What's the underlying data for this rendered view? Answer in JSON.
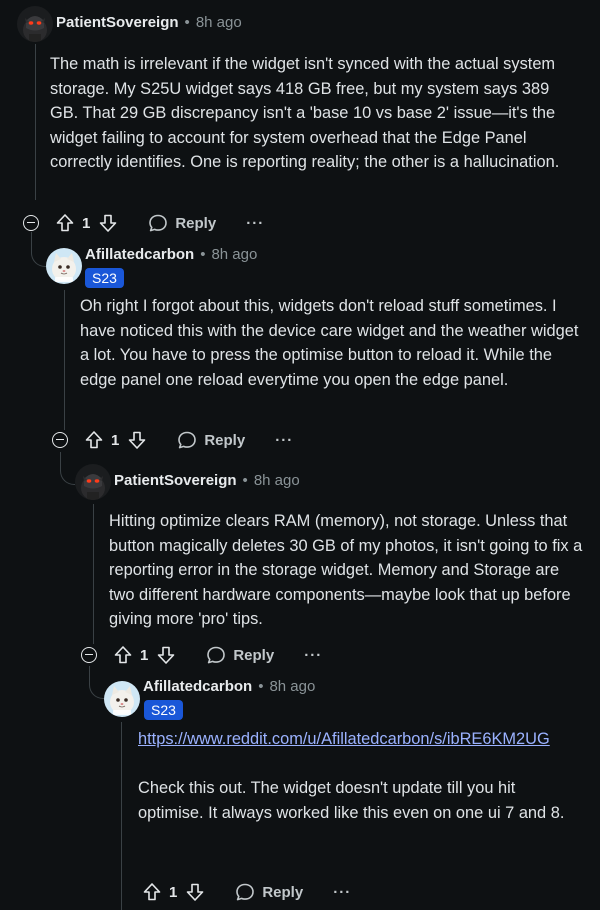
{
  "comments": [
    {
      "author": "PatientSovereign",
      "separator": "•",
      "time": "8h ago",
      "paragraphs": [
        "The math is irrelevant if the widget isn't synced with the actual system storage. My S25U widget says 418 GB free, but my system says 389 GB. That 29 GB discrepancy isn't a 'base 10 vs base 2' issue—it's the widget failing to account for system overhead that the Edge Panel correctly identifies. One is reporting reality; the other is a hallucination."
      ],
      "votes": "1",
      "reply_label": "Reply",
      "more_label": "···",
      "avatar_icon": "dark-robot-avatar"
    },
    {
      "author": "Afillatedcarbon",
      "separator": "•",
      "time": "8h ago",
      "flair": "S23",
      "paragraphs": [
        "Oh right I forgot about this, widgets don't reload stuff sometimes. I have noticed this with the device care widget and the weather widget a lot. You have to press the optimise button to reload it. While the edge panel one reload everytime you open the edge panel."
      ],
      "votes": "1",
      "reply_label": "Reply",
      "more_label": "···",
      "avatar_icon": "cartoon-cat-avatar"
    },
    {
      "author": "PatientSovereign",
      "separator": "•",
      "time": "8h ago",
      "paragraphs": [
        "Hitting optimize clears RAM (memory), not storage. Unless that button magically deletes 30 GB of my photos, it isn't going to fix a reporting error in the storage widget. Memory and Storage are two different hardware components—maybe look that up before giving more 'pro' tips."
      ],
      "votes": "1",
      "reply_label": "Reply",
      "more_label": "···",
      "avatar_icon": "dark-robot-avatar"
    },
    {
      "author": "Afillatedcarbon",
      "separator": "•",
      "time": "8h ago",
      "flair": "S23",
      "link": "https://www.reddit.com/u/Afillatedcarbon/s/ibRE6KM2UG",
      "paragraphs": [
        "Check this out. The widget doesn't update till you hit optimise. It always worked like this even on one ui 7 and 8."
      ],
      "votes": "1",
      "reply_label": "Reply",
      "more_label": "···",
      "avatar_icon": "cartoon-cat-avatar"
    }
  ],
  "colors": {
    "background": "#0e1113",
    "text": "#dfe3e6",
    "muted": "#8a9397",
    "flair": "#1a57d8",
    "link": "#9bb2ff",
    "thread_line": "#3a4145"
  }
}
